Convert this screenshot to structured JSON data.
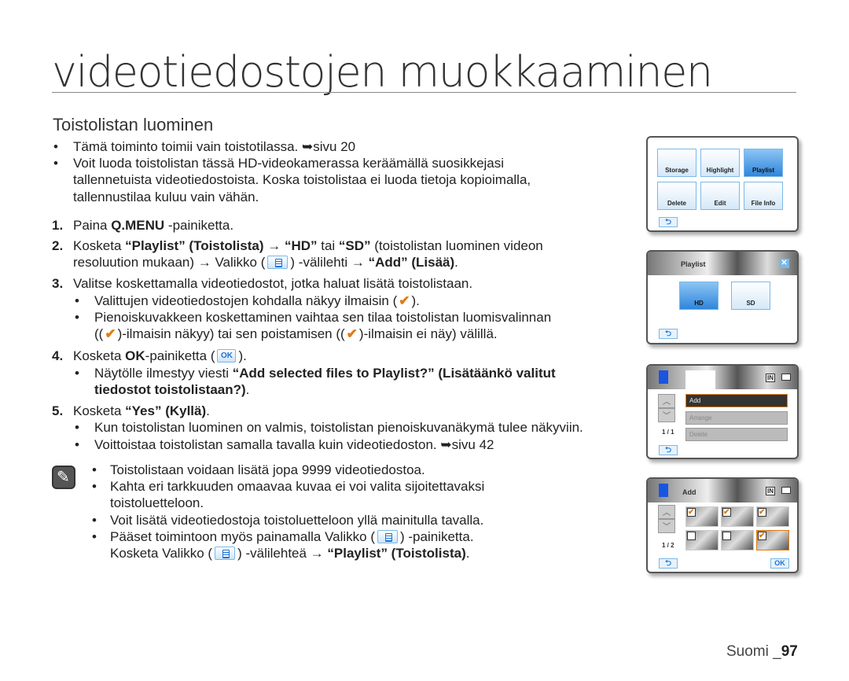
{
  "title": "videotiedostojen muokkaaminen",
  "subtitle": "Toistolistan luominen",
  "lines": [
    {
      "m": "•",
      "segs": [
        {
          "t": "Tämä toiminto toimii vain toistotilassa. ➥sivu 20"
        }
      ]
    },
    {
      "m": "•",
      "segs": [
        {
          "t": "Voit luoda toistolistan tässä HD-videokamerassa keräämällä suosikkejasi"
        }
      ]
    },
    {
      "segs": [
        {
          "t": "tallennetuista videotiedostoista. Koska toistolistaa ei luoda tietoja kopioimalla,"
        }
      ]
    },
    {
      "segs": [
        {
          "t": "tallennustilaa kuluu vain vähän."
        }
      ]
    },
    {
      "m": "1.",
      "segs": [
        {
          "t": "Paina "
        },
        {
          "b": "Q.MENU"
        },
        {
          "t": " -painiketta."
        }
      ]
    },
    {
      "m": "2.",
      "segs": [
        {
          "t": "Kosketa "
        },
        {
          "b": "“Playlist” (Toistolista)"
        },
        {
          "t": " → "
        },
        {
          "b": "“HD”"
        },
        {
          "t": " tai "
        },
        {
          "b": "“SD”"
        },
        {
          "t": " (toistolistan luominen videon"
        }
      ]
    },
    {
      "segs": [
        {
          "t": "resoluution mukaan) → Valikko ("
        },
        {
          "i": "menu-tab-icon"
        },
        {
          "t": ") -välilehti → "
        },
        {
          "b": "“Add” (Lisää)"
        },
        {
          "t": "."
        }
      ]
    },
    {
      "m": "3.",
      "segs": [
        {
          "t": "Valitse koskettamalla videotiedostot, jotka haluat lisätä toistolistaan."
        }
      ]
    },
    {
      "m": "•",
      "segs": [
        {
          "t": "Valittujen videotiedostojen kohdalla näkyy ilmaisin ("
        },
        {
          "i": "check-icon"
        },
        {
          "t": ")."
        }
      ]
    },
    {
      "m": "•",
      "segs": [
        {
          "t": "Pienoiskuvakkeen koskettaminen vaihtaa sen tilaa toistolistan luomisvalinnan"
        }
      ]
    },
    {
      "segs": [
        {
          "t": "(("
        },
        {
          "i": "check-icon"
        },
        {
          "t": ")-ilmaisin näkyy) tai sen poistamisen (("
        },
        {
          "i": "check-icon"
        },
        {
          "t": ")-ilmaisin ei näy) välillä."
        }
      ]
    },
    {
      "m": "4.",
      "segs": [
        {
          "t": "Kosketa "
        },
        {
          "b": "OK"
        },
        {
          "t": "-painiketta ("
        },
        {
          "i": "ok-icon"
        },
        {
          "t": ")."
        }
      ]
    },
    {
      "m": "•",
      "segs": [
        {
          "t": "Näytölle ilmestyy viesti "
        },
        {
          "b": "“Add selected files to Playlist?” (Lisätäänkö valitut"
        }
      ]
    },
    {
      "segs": [
        {
          "b": "tiedostot toistolistaan?)"
        },
        {
          "t": "."
        }
      ]
    },
    {
      "m": "5.",
      "segs": [
        {
          "t": "Kosketa "
        },
        {
          "b": "“Yes” (Kyllä)"
        },
        {
          "t": "."
        }
      ]
    },
    {
      "m": "•",
      "segs": [
        {
          "t": "Kun toistolistan luominen on valmis, toistolistan pienoiskuvanäkymä tulee näkyviin."
        }
      ]
    },
    {
      "m": "•",
      "segs": [
        {
          "t": "Voittoistaa toistolistan samalla tavalla kuin videotiedoston. ➥sivu 42"
        }
      ]
    },
    {
      "m": "•",
      "segs": [
        {
          "t": "Toistolistaan voidaan lisätä jopa 9999 videotiedostoa."
        }
      ]
    },
    {
      "m": "•",
      "segs": [
        {
          "t": "Kahta eri tarkkuuden omaavaa kuvaa ei voi valita sijoitettavaksi"
        }
      ]
    },
    {
      "segs": [
        {
          "t": "toistoluetteloon."
        }
      ]
    },
    {
      "m": "•",
      "segs": [
        {
          "t": "Voit lisätä videotiedostoja toistoluetteloon yllä mainitulla tavalla."
        }
      ]
    },
    {
      "m": "•",
      "segs": [
        {
          "t": "Pääset toimintoon myös painamalla Valikko ("
        },
        {
          "i": "menu-tab-icon"
        },
        {
          "t": ") -painiketta."
        }
      ]
    },
    {
      "segs": [
        {
          "t": "Kosketa Valikko ("
        },
        {
          "i": "menu-tab-icon"
        },
        {
          "t": ") -välilehteä → "
        },
        {
          "b": "“Playlist” (Toistolista)"
        },
        {
          "t": "."
        }
      ]
    }
  ],
  "screens": {
    "menu": {
      "tiles": [
        "Storage",
        "Highlight",
        "Playlist",
        "Delete",
        "Edit",
        "File Info"
      ],
      "selected": "Playlist"
    },
    "playlist": {
      "title": "Playlist",
      "options": [
        "HD",
        "SD"
      ],
      "selected": "HD"
    },
    "edit": {
      "items": [
        "Add",
        "Arrange",
        "Delete"
      ],
      "page": "1 / 1",
      "status": "IN"
    },
    "add": {
      "title": "Add",
      "page": "1 / 2",
      "ok": "OK",
      "status": "IN",
      "checked": [
        true,
        true,
        true,
        false,
        false,
        true
      ]
    }
  },
  "accent": "#1a73d6",
  "footer": {
    "lang": "Suomi _",
    "page": "97"
  }
}
